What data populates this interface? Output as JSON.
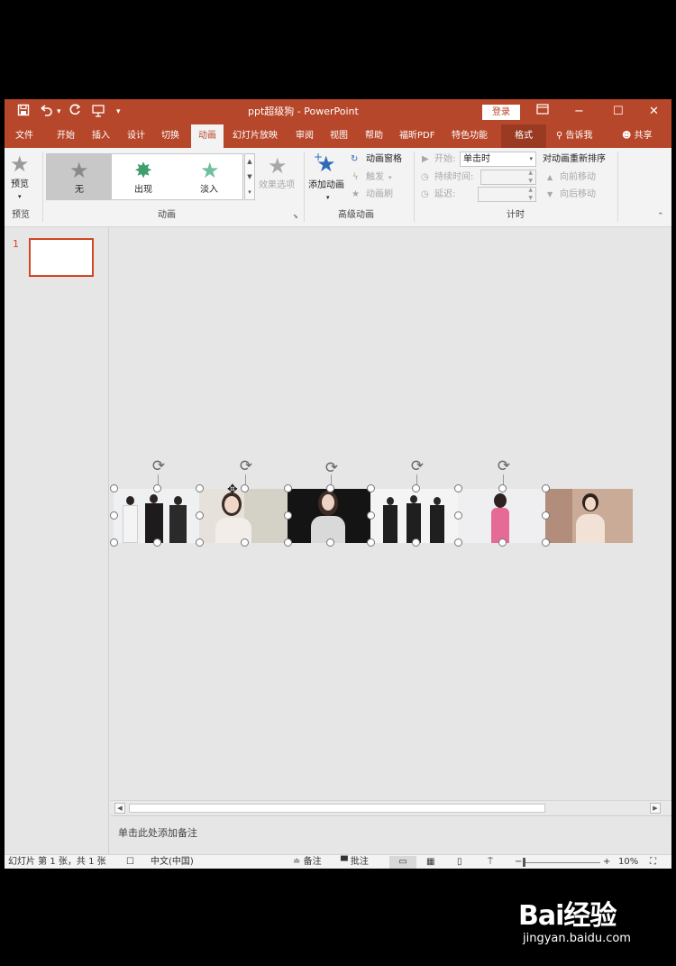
{
  "titlebar": {
    "title": "ppt超级狗 - PowerPoint",
    "login": "登录",
    "save_icon": "save-icon",
    "undo_icon": "undo-icon",
    "redo_icon": "redo-icon",
    "start_icon": "present-icon",
    "customize": "▾",
    "restore_icon": "ribbon-display-icon",
    "min": "−",
    "max": "☐",
    "close": "✕"
  },
  "tabs": [
    {
      "label": "文件"
    },
    {
      "label": "开始"
    },
    {
      "label": "插入"
    },
    {
      "label": "设计"
    },
    {
      "label": "切换"
    },
    {
      "label": "动画"
    },
    {
      "label": "幻灯片放映"
    },
    {
      "label": "审阅"
    },
    {
      "label": "视图"
    },
    {
      "label": "帮助"
    },
    {
      "label": "福昕PDF"
    },
    {
      "label": "特色功能"
    },
    {
      "label": "格式"
    }
  ],
  "tell_me": "告诉我",
  "share": "共享",
  "ribbon": {
    "preview_label": "预览",
    "preview_group": "预览",
    "gallery": [
      {
        "label": "无"
      },
      {
        "label": "出现"
      },
      {
        "label": "淡入"
      }
    ],
    "effect_options": "效果选项",
    "animation_group": "动画",
    "add_animation": "添加动画",
    "animation_pane": "动画窗格",
    "trigger": "触发",
    "animation_painter": "动画刷",
    "advanced_group": "高级动画",
    "start_label": "开始:",
    "start_value": "单击时",
    "duration_label": "持续时间:",
    "delay_label": "延迟:",
    "timing_group": "计时",
    "reorder_title": "对动画重新排序",
    "move_earlier": "向前移动",
    "move_later": "向后移动"
  },
  "thumbnail": {
    "number": "1"
  },
  "notes_placeholder": "单击此处添加备注",
  "status": {
    "slide_info": "幻灯片 第 1 张，共 1 张",
    "language": "中文(中国)",
    "notes": "备注",
    "comments": "批注",
    "zoom_minus": "−",
    "zoom_plus": "+",
    "zoom": "10%"
  },
  "watermark": {
    "logo": "Bai经验",
    "url": "jingyan.baidu.com"
  },
  "colors": {
    "accent": "#b7472a",
    "selection": "#d24726"
  }
}
